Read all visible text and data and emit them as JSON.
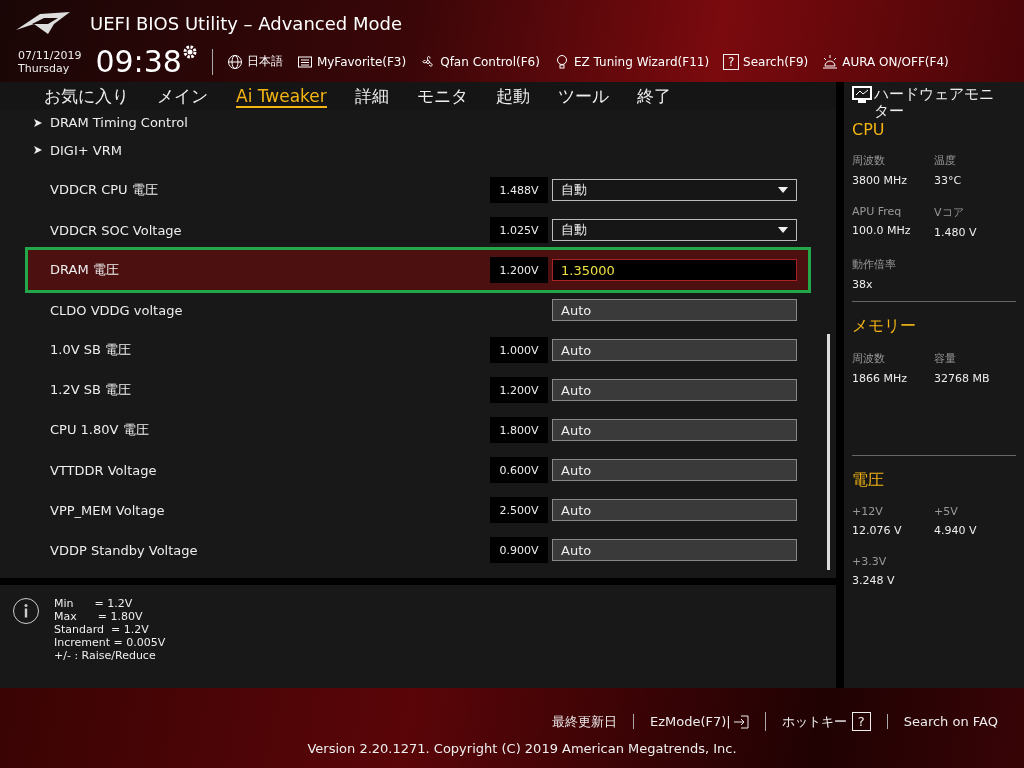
{
  "header": {
    "title": "UEFI BIOS Utility – Advanced Mode",
    "date": "07/11/2019",
    "weekday": "Thursday",
    "time": "09:38",
    "tools": [
      {
        "kind": "globe",
        "label": "日本語"
      },
      {
        "kind": "favorite",
        "label": "MyFavorite(F3)"
      },
      {
        "kind": "fan",
        "label": "Qfan Control(F6)"
      },
      {
        "kind": "bulb",
        "label": "EZ Tuning Wizard(F11)"
      },
      {
        "kind": "help",
        "label": "Search(F9)",
        "glyph": "?"
      },
      {
        "kind": "aura",
        "label": "AURA ON/OFF(F4)"
      }
    ]
  },
  "tabs": [
    {
      "label": "お気に入り",
      "selected": false
    },
    {
      "label": "メイン",
      "selected": false
    },
    {
      "label": "Ai Tweaker",
      "selected": true
    },
    {
      "label": "詳細",
      "selected": false
    },
    {
      "label": "モニタ",
      "selected": false
    },
    {
      "label": "起動",
      "selected": false
    },
    {
      "label": "ツール",
      "selected": false
    },
    {
      "label": "終了",
      "selected": false
    }
  ],
  "settings": [
    {
      "kind": "submenu",
      "label": "DRAM Timing Control",
      "selected": false,
      "outlined": false
    },
    {
      "kind": "submenu",
      "label": "DIGI+ VRM",
      "selected": false,
      "outlined": false
    },
    {
      "kind": "dropdown",
      "label": "VDDCR CPU 電圧",
      "reading": "1.488V",
      "value": "自動",
      "selected": false,
      "outlined": false
    },
    {
      "kind": "dropdown",
      "label": "VDDCR SOC Voltage",
      "reading": "1.025V",
      "value": "自動",
      "selected": false,
      "outlined": false
    },
    {
      "kind": "field",
      "label": "DRAM 電圧",
      "reading": "1.200V",
      "value": "1.35000",
      "selected": true,
      "outlined": true
    },
    {
      "kind": "field",
      "label": "CLDO VDDG voltage",
      "value": "Auto",
      "selected": false,
      "outlined": false
    },
    {
      "kind": "field",
      "label": "1.0V SB 電圧",
      "reading": "1.000V",
      "value": "Auto",
      "selected": false,
      "outlined": false
    },
    {
      "kind": "field",
      "label": "1.2V SB 電圧",
      "reading": "1.200V",
      "value": "Auto",
      "selected": false,
      "outlined": false
    },
    {
      "kind": "field",
      "label": "CPU 1.80V 電圧",
      "reading": "1.800V",
      "value": "Auto",
      "selected": false,
      "outlined": false
    },
    {
      "kind": "field",
      "label": "VTTDDR Voltage",
      "reading": "0.600V",
      "value": "Auto",
      "selected": false,
      "outlined": false
    },
    {
      "kind": "field",
      "label": "VPP_MEM Voltage",
      "reading": "2.500V",
      "value": "Auto",
      "selected": false,
      "outlined": false
    },
    {
      "kind": "field",
      "label": "VDDP Standby Voltage",
      "reading": "0.900V",
      "value": "Auto",
      "selected": false,
      "outlined": false
    }
  ],
  "help_lines": [
    "Min      = 1.2V",
    "Max      = 1.80V",
    "Standard  = 1.2V",
    "Increment = 0.005V",
    "+/- : Raise/Reduce"
  ],
  "monitor": {
    "title": "ハードウェアモニター",
    "sections": [
      {
        "title": "CPU",
        "items": [
          {
            "label": "周波数",
            "value": "3800 MHz"
          },
          {
            "label": "温度",
            "value": "33°C"
          },
          {
            "label": "APU Freq",
            "value": "100.0 MHz"
          },
          {
            "label": "Vコア",
            "value": "1.480 V"
          },
          {
            "label": "動作倍率",
            "value": "38x"
          }
        ]
      },
      {
        "title": "メモリー",
        "items": [
          {
            "label": "周波数",
            "value": "1866 MHz"
          },
          {
            "label": "容量",
            "value": "32768 MB"
          }
        ]
      },
      {
        "title": "電圧",
        "items": [
          {
            "label": "+12V",
            "value": "12.076 V"
          },
          {
            "label": "+5V",
            "value": "4.940 V"
          },
          {
            "label": "+3.3V",
            "value": "3.248 V"
          }
        ]
      }
    ]
  },
  "footer": {
    "links": [
      {
        "kind": "plain",
        "label": "最終更新日"
      },
      {
        "kind": "exit",
        "label": "EzMode(F7)|"
      },
      {
        "kind": "help",
        "label": "ホットキー",
        "glyph": "?"
      },
      {
        "kind": "plain",
        "label": "Search on FAQ"
      }
    ],
    "copyright": "Version 2.20.1271. Copyright (C) 2019 American Megatrends, Inc."
  }
}
